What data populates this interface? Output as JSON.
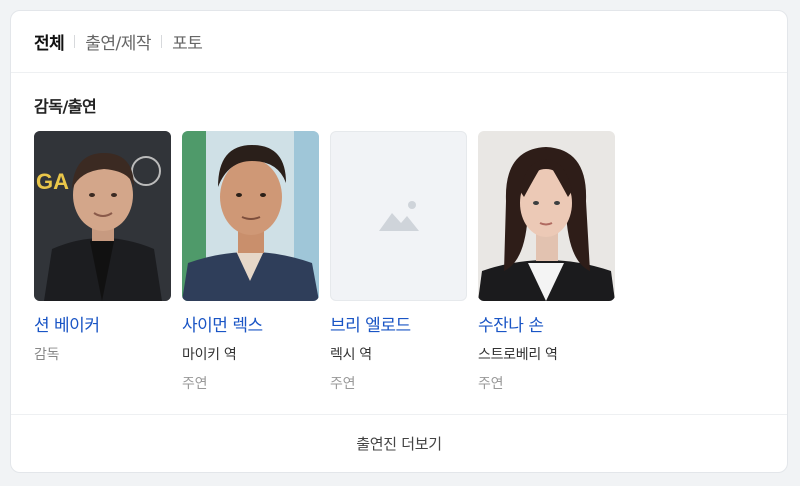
{
  "tabs": [
    {
      "label": "전체",
      "active": true
    },
    {
      "label": "출연/제작",
      "active": false
    },
    {
      "label": "포토",
      "active": false
    }
  ],
  "section_title": "감독/출연",
  "people": [
    {
      "name": "션 베이커",
      "role": "감독",
      "credit": ""
    },
    {
      "name": "사이먼 렉스",
      "role": "마이키 역",
      "credit": "주연"
    },
    {
      "name": "브리 엘로드",
      "role": "렉시 역",
      "credit": "주연"
    },
    {
      "name": "수잔나 손",
      "role": "스트로베리 역",
      "credit": "주연"
    }
  ],
  "more_label": "출연진 더보기",
  "colors": {
    "link": "#1a55c5",
    "placeholder_bg": "#f1f3f6",
    "placeholder_icon": "#cfd4da"
  }
}
